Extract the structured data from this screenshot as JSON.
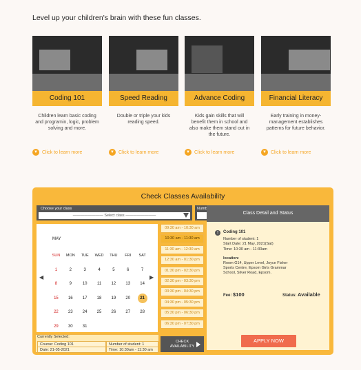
{
  "headline": "Level up your children's brain with these fun classes.",
  "cards": [
    {
      "title": "Coding 101",
      "desc": "Children learn basic coding and programin, logic, problem solving and more.",
      "more": "Click to learn more"
    },
    {
      "title": "Speed Reading",
      "desc": "Double or triple your kids reading speed.",
      "more": "Click to learn more"
    },
    {
      "title": "Advance Coding",
      "desc": "Kids gain skills that will benefit them in school and also make them stand out in the future.",
      "more": "Click to learn more"
    },
    {
      "title": "Financial Literacy",
      "desc": "Early training in money-management establishes patterns for future behavior.",
      "more": "Click to learn more"
    }
  ],
  "panel": {
    "title": "Check Classes Availability",
    "choose_label": "Choose your class",
    "select_placeholder": "———————— Select class ————————",
    "num_label": "Number of student:",
    "month": "MAY",
    "weekdays": [
      "SUN",
      "MON",
      "TUE",
      "WED",
      "THU",
      "FRI",
      "SAT"
    ],
    "weeks": [
      [
        "1",
        "2",
        "3",
        "4",
        "5",
        "6",
        "7"
      ],
      [
        "8",
        "9",
        "10",
        "11",
        "12",
        "13",
        "14"
      ],
      [
        "15",
        "16",
        "17",
        "18",
        "19",
        "20",
        "21"
      ],
      [
        "22",
        "23",
        "24",
        "25",
        "26",
        "27",
        "28"
      ],
      [
        "29",
        "30",
        "31",
        "",
        "",
        "",
        ""
      ]
    ],
    "selected_day": "21",
    "times": [
      "09:30 am - 10:30 am",
      "10:30 am - 11:30 am",
      "11:30 am - 12:30 am",
      "12:30 am - 01:30 pm",
      "01:30 pm - 02:30 pm",
      "02:30 pm - 03:30 pm",
      "03:30 pm - 04:30 pm",
      "04:30 pm - 05:30 pm",
      "05:30 pm - 06:30 pm",
      "06:30 pm - 07:30 pm"
    ],
    "active_time_index": 1,
    "currently_selected": "Currently Selected:",
    "course": "Course: Coding 101",
    "students": "Number of student: 1",
    "date": "Date: 21-05-2021",
    "time": "Time: 10:30am - 11:30 am",
    "check_label": "CHECK AVAILABILITY"
  },
  "detail": {
    "header": "Class Detail and Status",
    "icon": "info-icon",
    "class_name": "Coding 101",
    "students": "Number of student: 1",
    "start": "Start Date: 21 May, 2021(Sat)",
    "time": "Time: 10:30 am - 11:30am",
    "location_label": "location:",
    "location": "Room G14, Upper Level, Joyce Fisher Sports Centre, Epsom Girls Grammar School, Silver Road, Epsom.",
    "fee_label": "Fee:",
    "fee": "$100",
    "status_label": "Status:",
    "status": "Available",
    "apply": "APPLY NOW"
  },
  "colors": {
    "accent": "#f5b531",
    "apply": "#f06b4d",
    "dark": "#555555"
  }
}
